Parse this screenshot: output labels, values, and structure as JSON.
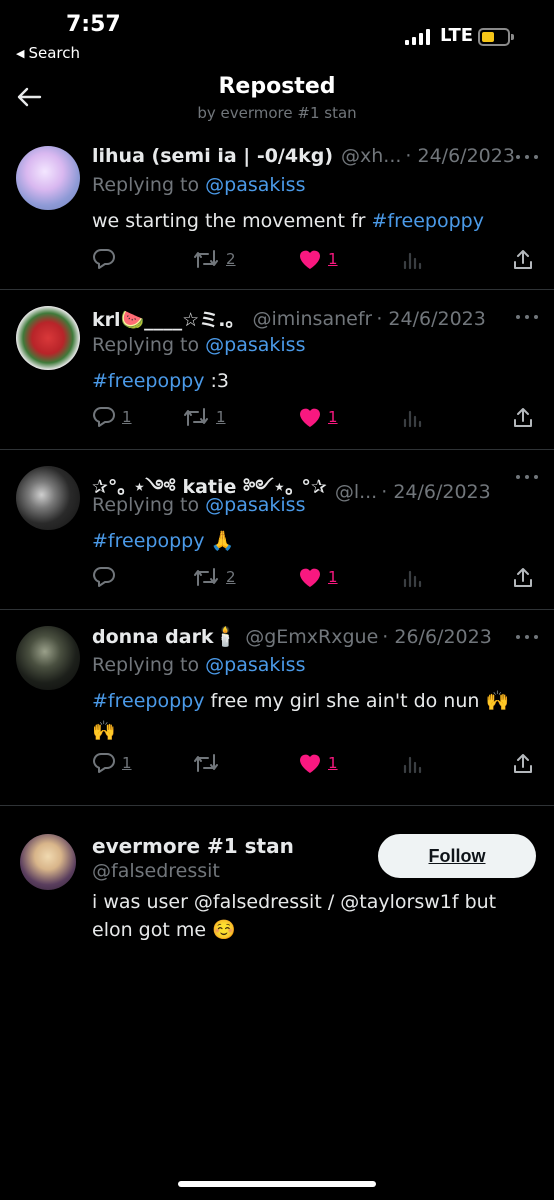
{
  "status_bar": {
    "time": "7:57",
    "back_label": "Search",
    "carrier": "LTE",
    "battery_color": "#f5c518"
  },
  "header": {
    "title": "Reposted",
    "subtitle": "by evermore #1 stan"
  },
  "tweets": [
    {
      "name": "lihua (semi ia | -0/4kg)",
      "handle": "@xh...",
      "date": "· 24/6/2023",
      "reply_prefix": "Replying to ",
      "reply_to": "@pasakiss",
      "text_before": "we starting the movement fr ",
      "hashtag": "#freepoppy",
      "text_after": "",
      "replies": "",
      "retweets": "2",
      "likes": "1"
    },
    {
      "name": "krl🍉____☆ミ.。",
      "handle": "@iminsanefr",
      "date": "· 24/6/2023",
      "reply_prefix": "Replying to ",
      "reply_to": "@pasakiss",
      "text_before": "",
      "hashtag": "#freepoppy",
      "text_after": " :3",
      "replies": "1",
      "retweets": "1",
      "likes": "1"
    },
    {
      "name": "✰°｡ ⋆༺ katie ༻⋆｡ °✰",
      "handle": "@l...",
      "date": "· 24/6/2023",
      "reply_prefix": "Replying to ",
      "reply_to": "@pasakiss",
      "text_before": "",
      "hashtag": "#freepoppy",
      "text_after": " 🙏",
      "replies": "",
      "retweets": "2",
      "likes": "1"
    },
    {
      "name": "donna dark🕯️",
      "handle": "@gEmxRxgue",
      "date": "· 26/6/2023",
      "reply_prefix": "Replying to ",
      "reply_to": "@pasakiss",
      "text_before": "",
      "hashtag": "#freepoppy",
      "text_after": " free my girl she ain't do nun 🙌 🙌",
      "replies": "1",
      "retweets": "",
      "likes": "1"
    }
  ],
  "profile": {
    "name": "evermore #1 stan",
    "handle": "@falsedressit",
    "follow_label": "Follow",
    "bio": "i was user @falsedressit / @taylorsw1f but elon got me ☺️"
  },
  "colors": {
    "accent": "#4b9ae8",
    "like": "#f91880",
    "muted": "#71767b"
  }
}
